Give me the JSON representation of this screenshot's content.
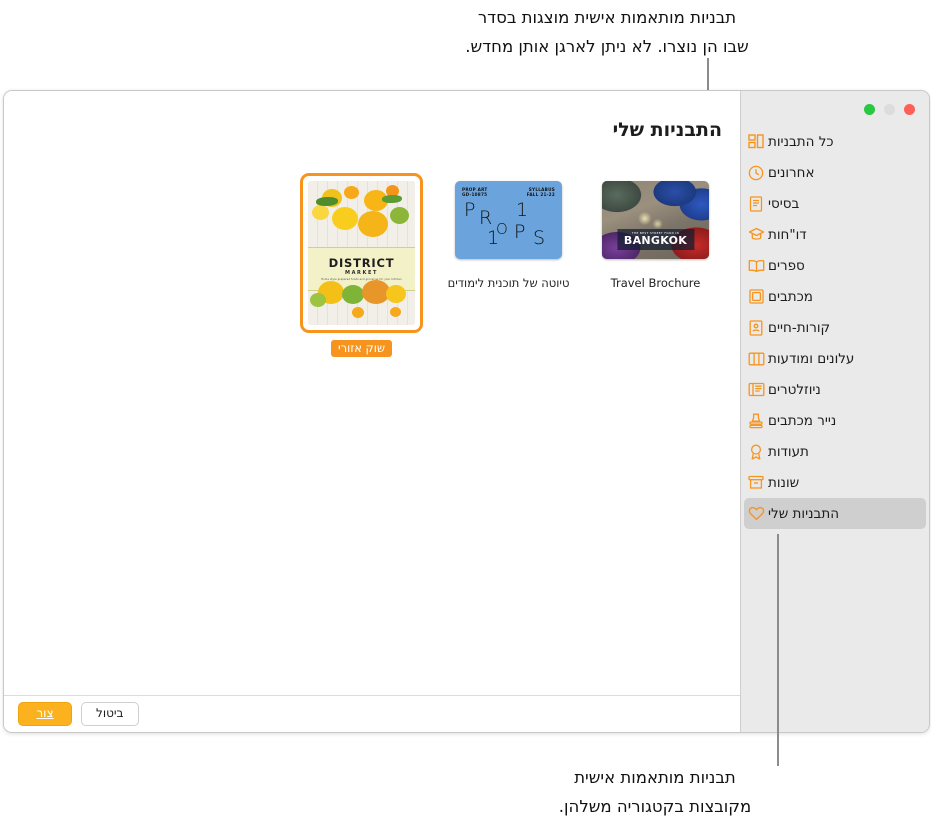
{
  "annotations": {
    "top": "תבניות מותאמות אישית מוצגות בסדר\nשבו הן נוצרו. לא ניתן לארגן אותן מחדש.",
    "bottom": "תבניות מותאמות אישית\nמקובצות בקטגוריה משלהן."
  },
  "window": {
    "traffic_lights": [
      {
        "name": "minimize-button",
        "color": "#28c940"
      },
      {
        "name": "zoom-button",
        "color": "#dcdcdc"
      },
      {
        "name": "close-button",
        "color": "#ff5f57"
      }
    ]
  },
  "sidebar": {
    "items": [
      {
        "label": "כל התבניות",
        "icon": "all-templates-icon",
        "selected": false
      },
      {
        "label": "אחרונים",
        "icon": "clock-icon",
        "selected": false
      },
      {
        "label": "בסיסי",
        "icon": "document-icon",
        "selected": false
      },
      {
        "label": "דו\"חות",
        "icon": "graduation-cap-icon",
        "selected": false
      },
      {
        "label": "ספרים",
        "icon": "book-icon",
        "selected": false
      },
      {
        "label": "מכתבים",
        "icon": "frame-icon",
        "selected": false
      },
      {
        "label": "קורות-חיים",
        "icon": "resume-icon",
        "selected": false
      },
      {
        "label": "עלונים ומודעות",
        "icon": "brochure-icon",
        "selected": false
      },
      {
        "label": "ניוזלטרים",
        "icon": "newsletter-icon",
        "selected": false
      },
      {
        "label": "נייר מכתבים",
        "icon": "stamp-icon",
        "selected": false
      },
      {
        "label": "תעודות",
        "icon": "award-icon",
        "selected": false
      },
      {
        "label": "שונות",
        "icon": "box-icon",
        "selected": false
      },
      {
        "label": "התבניות שלי",
        "icon": "heart-icon",
        "selected": true
      }
    ],
    "accent_color": "#f7941e",
    "selected_bg": "#cfcfcf"
  },
  "main": {
    "section_title": "התבניות שלי",
    "templates": [
      {
        "caption": "Travel Brochure",
        "selected": false,
        "thumb": {
          "kind": "photo-bangkok",
          "overlay_sub": "THE BEST STREET FOOD IN",
          "overlay_main": "BANGKOK"
        }
      },
      {
        "caption": "טיוטה של תוכנית לימודים",
        "selected": false,
        "thumb": {
          "kind": "props",
          "header_left": "PROP ART\nGD-10875",
          "header_right": "SYLLABUS\nFALL 21-22",
          "letters": [
            "P",
            "R",
            "O",
            "P",
            "S",
            "1",
            "1"
          ],
          "bg_color": "#6ba4dd"
        }
      },
      {
        "caption": "שוק אזורי",
        "selected": true,
        "thumb": {
          "kind": "district-market",
          "title": "DISTRICT",
          "subtitle": "MARKET",
          "tagline": "Home style prepared foods and groceries for your kitchen"
        }
      }
    ]
  },
  "bottom_bar": {
    "create_label": "צור",
    "cancel_label": "ביטול",
    "create_color": "#fcb11e"
  }
}
